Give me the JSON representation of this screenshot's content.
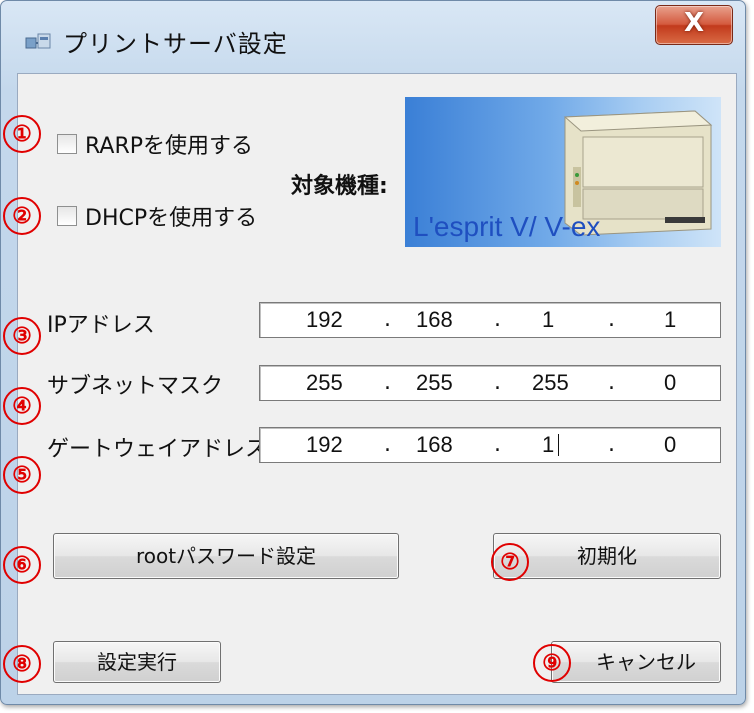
{
  "window": {
    "title": "プリントサーバ設定",
    "close_symbol": "X"
  },
  "markers": {
    "m1": "①",
    "m2": "②",
    "m3": "③",
    "m4": "④",
    "m5": "⑤",
    "m6": "⑥",
    "m7": "⑦",
    "m8": "⑧",
    "m9": "⑨"
  },
  "options": {
    "rarp_label": "RARPを使用する",
    "rarp_checked": false,
    "dhcp_label": "DHCPを使用する",
    "dhcp_checked": false
  },
  "target": {
    "label": "対象機種:",
    "model_name": "L'esprit V/ V-ex"
  },
  "network": {
    "ip_label": "IPアドレス",
    "ip": [
      "192",
      "168",
      "1",
      "1"
    ],
    "subnet_label": "サブネットマスク",
    "subnet": [
      "255",
      "255",
      "255",
      "0"
    ],
    "gateway_label": "ゲートウェイアドレス",
    "gateway": [
      "192",
      "168",
      "1",
      "0"
    ],
    "separator": "."
  },
  "buttons": {
    "root_password": "rootパスワード設定",
    "initialize": "初期化",
    "execute": "設定実行",
    "cancel": "キャンセル"
  },
  "icons": {
    "title_icon": "network-printer-icon",
    "close_icon": "close-icon"
  }
}
